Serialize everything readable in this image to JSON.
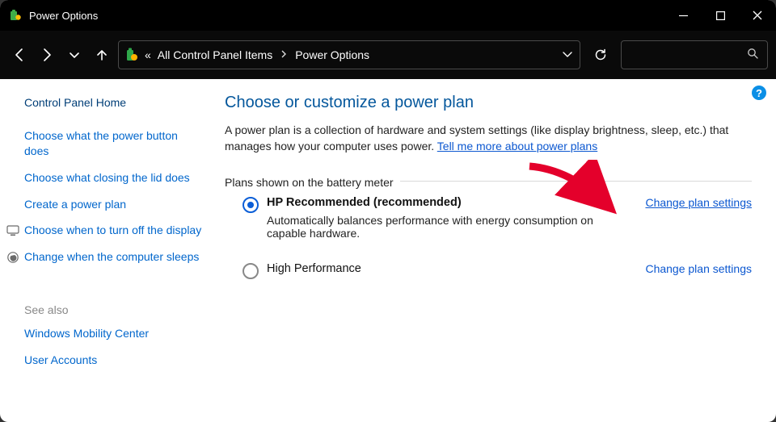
{
  "window": {
    "title": "Power Options"
  },
  "breadcrumb": {
    "guillemets": "«",
    "item1": "All Control Panel Items",
    "item2": "Power Options"
  },
  "sidebar": {
    "home": "Control Panel Home",
    "links": [
      "Choose what the power button does",
      "Choose what closing the lid does",
      "Create a power plan",
      "Choose when to turn off the display",
      "Change when the computer sleeps"
    ],
    "see_also_label": "See also",
    "see_also": [
      "Windows Mobility Center",
      "User Accounts"
    ]
  },
  "main": {
    "heading": "Choose or customize a power plan",
    "intro": "A power plan is a collection of hardware and system settings (like display brightness, sleep, etc.) that manages how your computer uses power. ",
    "tell_more": "Tell me more about power plans",
    "plans_label": "Plans shown on the battery meter",
    "plans": [
      {
        "name": "HP Recommended (recommended)",
        "selected": true,
        "desc": "Automatically balances performance with energy consumption on capable hardware.",
        "link": "Change plan settings",
        "link_emphasis": true
      },
      {
        "name": "High Performance",
        "selected": false,
        "desc": "",
        "link": "Change plan settings",
        "link_emphasis": false
      }
    ]
  },
  "help": "?"
}
